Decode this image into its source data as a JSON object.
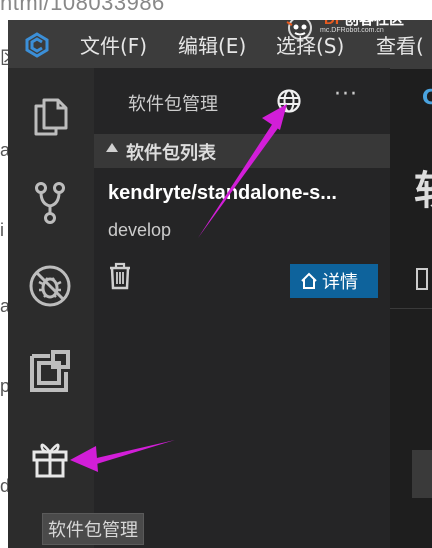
{
  "background": {
    "url_fragment": "ntml/108033986",
    "fragments": [
      "区",
      "a",
      "i",
      "a",
      "p",
      "d"
    ]
  },
  "watermark": {
    "brand": "DF",
    "brand_cn": "创客社区",
    "sub": "mc.DFRobot.com.cn"
  },
  "menubar": {
    "items": [
      "文件(F)",
      "编辑(E)",
      "选择(S)",
      "查看("
    ]
  },
  "activity_bar": {
    "items": [
      "explorer-icon",
      "source-control-icon",
      "debug-icon",
      "extensions-icon",
      "package-manager-icon"
    ],
    "tooltip": "软件包管理"
  },
  "sidebar": {
    "title": "软件包管理",
    "more_label": "···",
    "section_title": "软件包列表",
    "package": {
      "name": "kendryte/standalone-s...",
      "branch": "develop",
      "detail_label": "详情"
    }
  },
  "editor": {
    "tab_letter": "C",
    "heading_char": "软"
  },
  "colors": {
    "accent_button": "#0e639c",
    "annotation_arrow": "#d21ed8",
    "watermark_brand": "#e85a1f"
  }
}
